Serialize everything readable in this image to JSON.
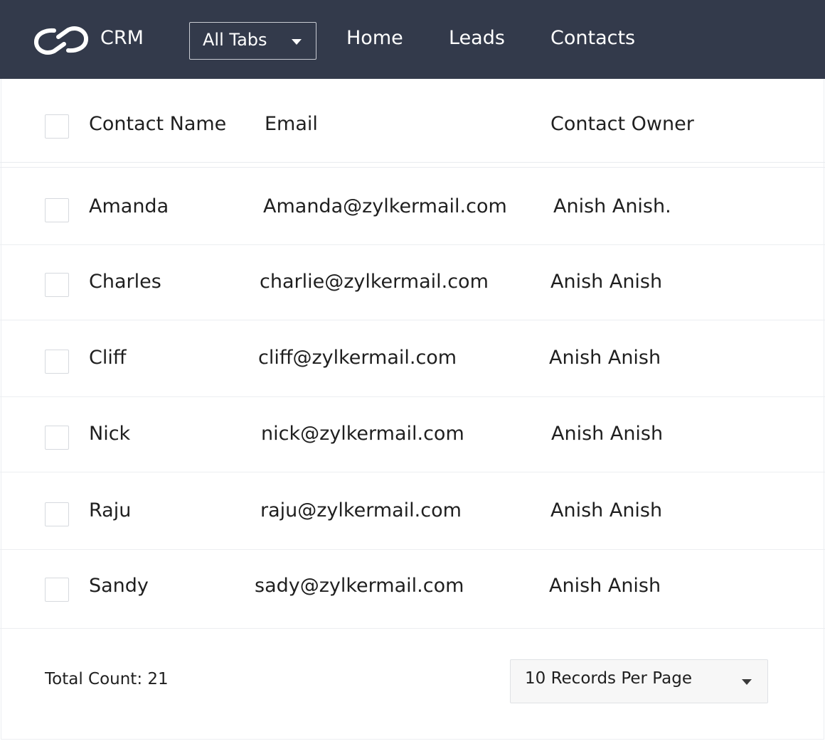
{
  "header": {
    "brand": "CRM",
    "tabs_dropdown": "All Tabs",
    "nav": [
      "Home",
      "Leads",
      "Contacts"
    ]
  },
  "table": {
    "columns": [
      "Contact Name",
      "Email",
      "Contact Owner"
    ],
    "rows": [
      {
        "name": "Amanda",
        "email": "Amanda@zylkermail.com",
        "owner": "Anish Anish."
      },
      {
        "name": "Charles",
        "email": "charlie@zylkermail.com",
        "owner": "Anish Anish"
      },
      {
        "name": "Cliff",
        "email": "cliff@zylkermail.com",
        "owner": "Anish Anish"
      },
      {
        "name": "Nick",
        "email": "nick@zylkermail.com",
        "owner": "Anish Anish"
      },
      {
        "name": "Raju",
        "email": "raju@zylkermail.com",
        "owner": "Anish Anish"
      },
      {
        "name": "Sandy",
        "email": "sady@zylkermail.com",
        "owner": "Anish Anish"
      }
    ]
  },
  "footer": {
    "total_count": "Total Count: 21",
    "per_page": "10 Records Per Page"
  },
  "icons": {
    "logo": "crm-rings-logo-icon",
    "tabs_caret": "caret-down-icon",
    "per_page_caret": "caret-down-icon"
  },
  "colors": {
    "topbar": "#333a4b",
    "topbar_text": "#ffffff"
  }
}
